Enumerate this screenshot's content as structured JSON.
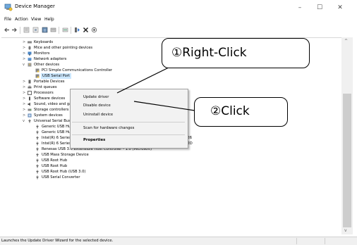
{
  "window": {
    "title": "Device Manager",
    "controls": {
      "minimize": "–",
      "maximize": "☐",
      "close": "✕"
    }
  },
  "menu": [
    "File",
    "Action",
    "View",
    "Help"
  ],
  "toolbar": [
    "back-icon",
    "forward-icon",
    "properties-icon",
    "show-hidden-icon",
    "help-icon",
    "monitor-icon",
    "scan-icon",
    "update-driver-icon",
    "remove-icon",
    "enable-icon"
  ],
  "tree": {
    "keyboards": "Keyboards",
    "mice": "Mice and other pointing devices",
    "monitors": "Monitors",
    "network": "Network adapters",
    "other": "Other devices",
    "pci_simple": "PCI Simple Communications Controller",
    "usb_serial_port": "USB Serial Port",
    "portable": "Portable Devices",
    "print_queues": "Print queues",
    "processors": "Processors",
    "software": "Software devices",
    "sound": "Sound, video and game controllers",
    "storage": "Storage controllers",
    "system": "System devices",
    "usb_controllers": "Universal Serial Bus controllers",
    "usb_children": [
      "Generic USB Hub",
      "Generic USB Hub",
      "Intel(R) 6 Series/C200 Series Chipset Family USB Enhanced Host Controller - 1C26",
      "Intel(R) 6 Series/C200 Series Chipset Family USB Enhanced Host Controller - 1C2D",
      "Renesas USB 3.0 eXtensible Host Controller - 1.0 (Microsoft)",
      "USB Mass Storage Device",
      "USB Root Hub",
      "USB Root Hub",
      "USB Root Hub (USB 3.0)",
      "USB Serial Converter"
    ]
  },
  "context_menu": {
    "update_driver": "Update driver",
    "disable_device": "Disable device",
    "uninstall_device": "Uninstall device",
    "scan_hardware": "Scan for hardware changes",
    "properties": "Properties"
  },
  "callouts": {
    "right_click": "①Right-Click",
    "click": "②Click"
  },
  "status": {
    "text": "Launches the Update Driver Wizard for the selected device."
  },
  "colors": {
    "selection": "#cce8ff",
    "menu_bg": "#f2f2f2"
  }
}
